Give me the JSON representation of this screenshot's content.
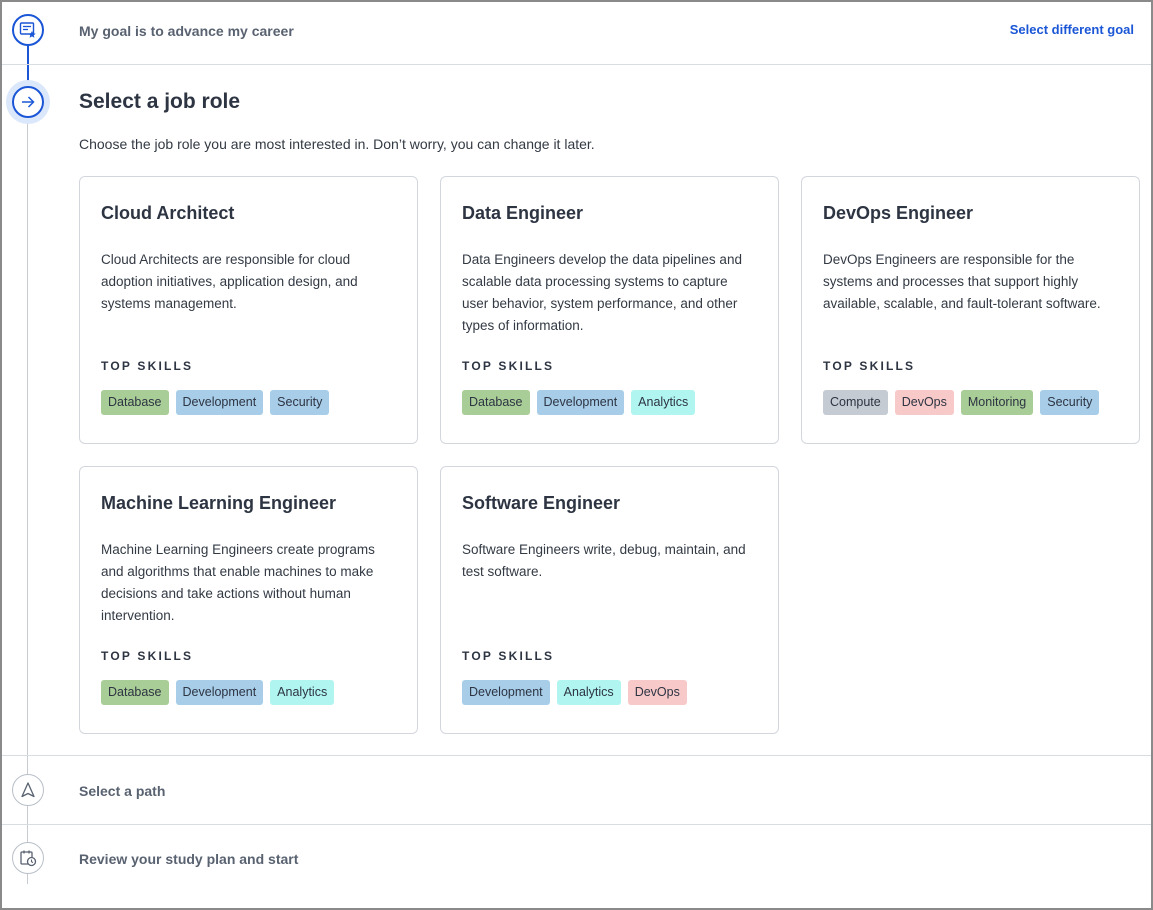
{
  "steps": {
    "goal": {
      "title": "My goal is to advance my career",
      "action_label": "Select different goal"
    },
    "job_role": {
      "title": "Select a job role",
      "description": "Choose the job role you are most interested in. Don’t worry, you can change it later."
    },
    "path": {
      "title": "Select a path"
    },
    "review": {
      "title": "Review your study plan and start"
    }
  },
  "skills_label": "TOP SKILLS",
  "roles": [
    {
      "title": "Cloud Architect",
      "description": "Cloud Architects are responsible for cloud adoption initiatives, application design, and systems management.",
      "skills": [
        "Database",
        "Development",
        "Security"
      ]
    },
    {
      "title": "Data Engineer",
      "description": "Data Engineers develop the data pipelines and scalable data processing systems to capture user behavior, system performance, and other types of information.",
      "skills": [
        "Database",
        "Development",
        "Analytics"
      ]
    },
    {
      "title": "DevOps Engineer",
      "description": "DevOps Engineers are responsible for the systems and processes that support highly available, scalable, and fault-tolerant software.",
      "skills": [
        "Compute",
        "DevOps",
        "Monitoring",
        "Security"
      ]
    },
    {
      "title": "Machine Learning Engineer",
      "description": "Machine Learning Engineers create programs and algorithms that enable machines to make decisions and take actions without human intervention.",
      "skills": [
        "Database",
        "Development",
        "Analytics"
      ]
    },
    {
      "title": "Software Engineer",
      "description": "Software Engineers write, debug, maintain, and test software.",
      "skills": [
        "Development",
        "Analytics",
        "DevOps"
      ]
    }
  ],
  "icons": {
    "goal": "certificate-star-icon",
    "job_role": "arrow-right-icon",
    "path": "navigation-arrow-icon",
    "review": "calendar-clock-icon"
  },
  "colors": {
    "accent": "#1a56d6",
    "tag_database": "#a9cd96",
    "tag_development": "#a7cde9",
    "tag_security": "#a7cde9",
    "tag_analytics": "#b0f5ef",
    "tag_compute": "#c5cbd3",
    "tag_devops": "#f8c9c9",
    "tag_monitoring": "#a9cd96"
  }
}
